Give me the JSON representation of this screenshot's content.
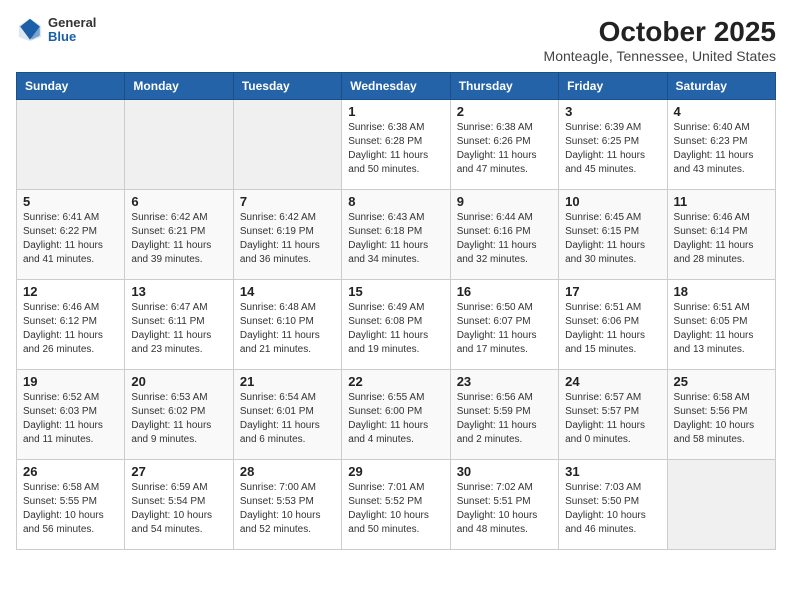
{
  "logo": {
    "general": "General",
    "blue": "Blue"
  },
  "title": "October 2025",
  "subtitle": "Monteagle, Tennessee, United States",
  "weekdays": [
    "Sunday",
    "Monday",
    "Tuesday",
    "Wednesday",
    "Thursday",
    "Friday",
    "Saturday"
  ],
  "weeks": [
    [
      {
        "day": "",
        "info": ""
      },
      {
        "day": "",
        "info": ""
      },
      {
        "day": "",
        "info": ""
      },
      {
        "day": "1",
        "info": "Sunrise: 6:38 AM\nSunset: 6:28 PM\nDaylight: 11 hours\nand 50 minutes."
      },
      {
        "day": "2",
        "info": "Sunrise: 6:38 AM\nSunset: 6:26 PM\nDaylight: 11 hours\nand 47 minutes."
      },
      {
        "day": "3",
        "info": "Sunrise: 6:39 AM\nSunset: 6:25 PM\nDaylight: 11 hours\nand 45 minutes."
      },
      {
        "day": "4",
        "info": "Sunrise: 6:40 AM\nSunset: 6:23 PM\nDaylight: 11 hours\nand 43 minutes."
      }
    ],
    [
      {
        "day": "5",
        "info": "Sunrise: 6:41 AM\nSunset: 6:22 PM\nDaylight: 11 hours\nand 41 minutes."
      },
      {
        "day": "6",
        "info": "Sunrise: 6:42 AM\nSunset: 6:21 PM\nDaylight: 11 hours\nand 39 minutes."
      },
      {
        "day": "7",
        "info": "Sunrise: 6:42 AM\nSunset: 6:19 PM\nDaylight: 11 hours\nand 36 minutes."
      },
      {
        "day": "8",
        "info": "Sunrise: 6:43 AM\nSunset: 6:18 PM\nDaylight: 11 hours\nand 34 minutes."
      },
      {
        "day": "9",
        "info": "Sunrise: 6:44 AM\nSunset: 6:16 PM\nDaylight: 11 hours\nand 32 minutes."
      },
      {
        "day": "10",
        "info": "Sunrise: 6:45 AM\nSunset: 6:15 PM\nDaylight: 11 hours\nand 30 minutes."
      },
      {
        "day": "11",
        "info": "Sunrise: 6:46 AM\nSunset: 6:14 PM\nDaylight: 11 hours\nand 28 minutes."
      }
    ],
    [
      {
        "day": "12",
        "info": "Sunrise: 6:46 AM\nSunset: 6:12 PM\nDaylight: 11 hours\nand 26 minutes."
      },
      {
        "day": "13",
        "info": "Sunrise: 6:47 AM\nSunset: 6:11 PM\nDaylight: 11 hours\nand 23 minutes."
      },
      {
        "day": "14",
        "info": "Sunrise: 6:48 AM\nSunset: 6:10 PM\nDaylight: 11 hours\nand 21 minutes."
      },
      {
        "day": "15",
        "info": "Sunrise: 6:49 AM\nSunset: 6:08 PM\nDaylight: 11 hours\nand 19 minutes."
      },
      {
        "day": "16",
        "info": "Sunrise: 6:50 AM\nSunset: 6:07 PM\nDaylight: 11 hours\nand 17 minutes."
      },
      {
        "day": "17",
        "info": "Sunrise: 6:51 AM\nSunset: 6:06 PM\nDaylight: 11 hours\nand 15 minutes."
      },
      {
        "day": "18",
        "info": "Sunrise: 6:51 AM\nSunset: 6:05 PM\nDaylight: 11 hours\nand 13 minutes."
      }
    ],
    [
      {
        "day": "19",
        "info": "Sunrise: 6:52 AM\nSunset: 6:03 PM\nDaylight: 11 hours\nand 11 minutes."
      },
      {
        "day": "20",
        "info": "Sunrise: 6:53 AM\nSunset: 6:02 PM\nDaylight: 11 hours\nand 9 minutes."
      },
      {
        "day": "21",
        "info": "Sunrise: 6:54 AM\nSunset: 6:01 PM\nDaylight: 11 hours\nand 6 minutes."
      },
      {
        "day": "22",
        "info": "Sunrise: 6:55 AM\nSunset: 6:00 PM\nDaylight: 11 hours\nand 4 minutes."
      },
      {
        "day": "23",
        "info": "Sunrise: 6:56 AM\nSunset: 5:59 PM\nDaylight: 11 hours\nand 2 minutes."
      },
      {
        "day": "24",
        "info": "Sunrise: 6:57 AM\nSunset: 5:57 PM\nDaylight: 11 hours\nand 0 minutes."
      },
      {
        "day": "25",
        "info": "Sunrise: 6:58 AM\nSunset: 5:56 PM\nDaylight: 10 hours\nand 58 minutes."
      }
    ],
    [
      {
        "day": "26",
        "info": "Sunrise: 6:58 AM\nSunset: 5:55 PM\nDaylight: 10 hours\nand 56 minutes."
      },
      {
        "day": "27",
        "info": "Sunrise: 6:59 AM\nSunset: 5:54 PM\nDaylight: 10 hours\nand 54 minutes."
      },
      {
        "day": "28",
        "info": "Sunrise: 7:00 AM\nSunset: 5:53 PM\nDaylight: 10 hours\nand 52 minutes."
      },
      {
        "day": "29",
        "info": "Sunrise: 7:01 AM\nSunset: 5:52 PM\nDaylight: 10 hours\nand 50 minutes."
      },
      {
        "day": "30",
        "info": "Sunrise: 7:02 AM\nSunset: 5:51 PM\nDaylight: 10 hours\nand 48 minutes."
      },
      {
        "day": "31",
        "info": "Sunrise: 7:03 AM\nSunset: 5:50 PM\nDaylight: 10 hours\nand 46 minutes."
      },
      {
        "day": "",
        "info": ""
      }
    ]
  ]
}
